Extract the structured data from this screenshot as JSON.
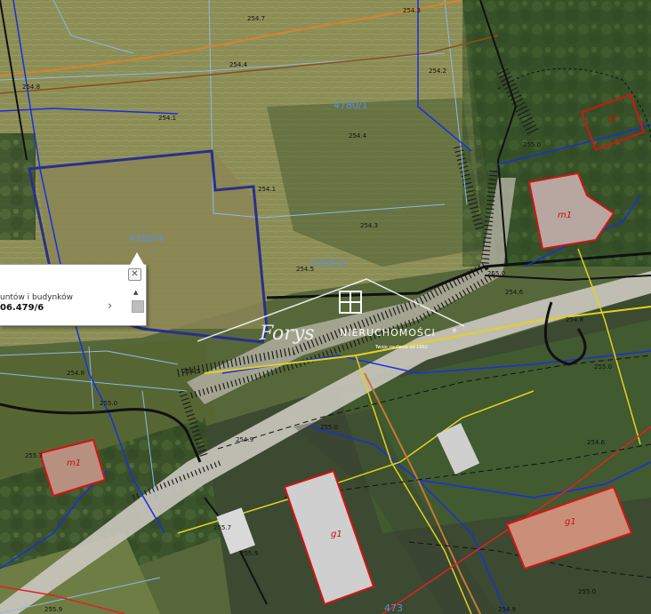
{
  "colors": {
    "parcel_border": "#2a2f8a",
    "boundary_light": "#8fb7e8",
    "utility_blue": "#1a2ee0",
    "utility_orange": "#d9822b",
    "utility_brown": "#8a4f1c",
    "utility_yellow": "#e2d21e",
    "utility_red": "#e02222",
    "building_outline": "#d21414",
    "road_fill": "#c9c6bd"
  },
  "parcels": {
    "p1": "4780/1",
    "p2": "4780/4",
    "p3": "4780/3",
    "p4": "473"
  },
  "elevations": {
    "e1": "254.7",
    "e2": "254.4",
    "e3": "254.3",
    "e4": "254.1",
    "e5": "254.8",
    "e6": "254.2",
    "e7": "254.4",
    "e8": "254.1",
    "e9": "254.3",
    "e10": "254.5",
    "e11": "255.0",
    "e12": "254.6",
    "e13": "255.0",
    "e14": "254.5",
    "e15": "254.8",
    "e16": "255.0",
    "e17": "254.9",
    "e18": "255.3",
    "e19": "255.7",
    "e20": "255.9",
    "e21": "255.9",
    "e22": "255.0",
    "e23": "254.6",
    "e24": "255.0",
    "e25": "254.8",
    "e26": "255.0",
    "e27": "254.9"
  },
  "buildings": {
    "b1": "g1",
    "b2": "m1",
    "b3": "m1",
    "b4": "g1",
    "b5": "g1"
  },
  "popup": {
    "close_glyph": "✕",
    "title": "untów i budynków",
    "value": "06.479/6",
    "chevron": "›",
    "scroll_up": "▲"
  },
  "watermark": {
    "script_text": "Forys",
    "brand": "NIERUCHOMOŚCI",
    "reg": "®",
    "tagline": "Twoje zaufanie od 1992"
  }
}
